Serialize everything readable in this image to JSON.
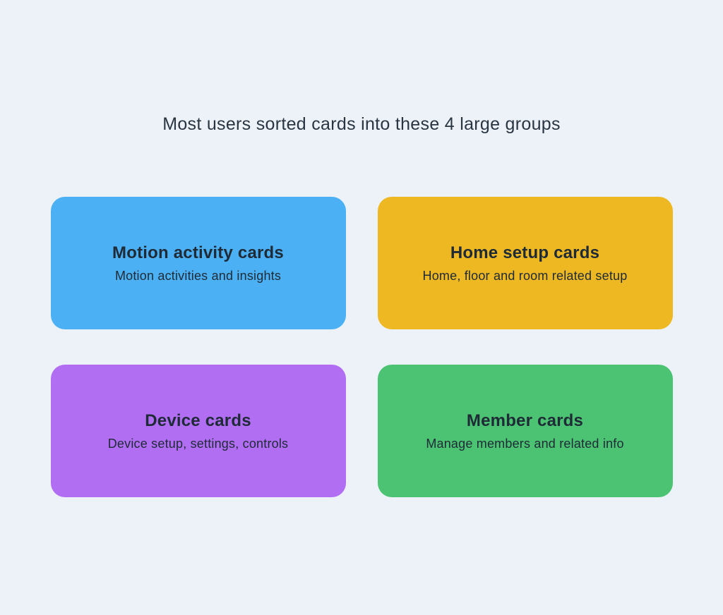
{
  "heading": "Most users sorted cards into these 4 large groups",
  "cards": [
    {
      "title": "Motion activity cards",
      "desc": "Motion activities and insights",
      "color": "#4cb1f4"
    },
    {
      "title": "Home setup cards",
      "desc": "Home, floor and room related setup",
      "color": "#eeb823"
    },
    {
      "title": "Device cards",
      "desc": "Device setup, settings, controls",
      "color": "#b16ef3"
    },
    {
      "title": "Member cards",
      "desc": "Manage members and  related info",
      "color": "#4cc372"
    }
  ]
}
